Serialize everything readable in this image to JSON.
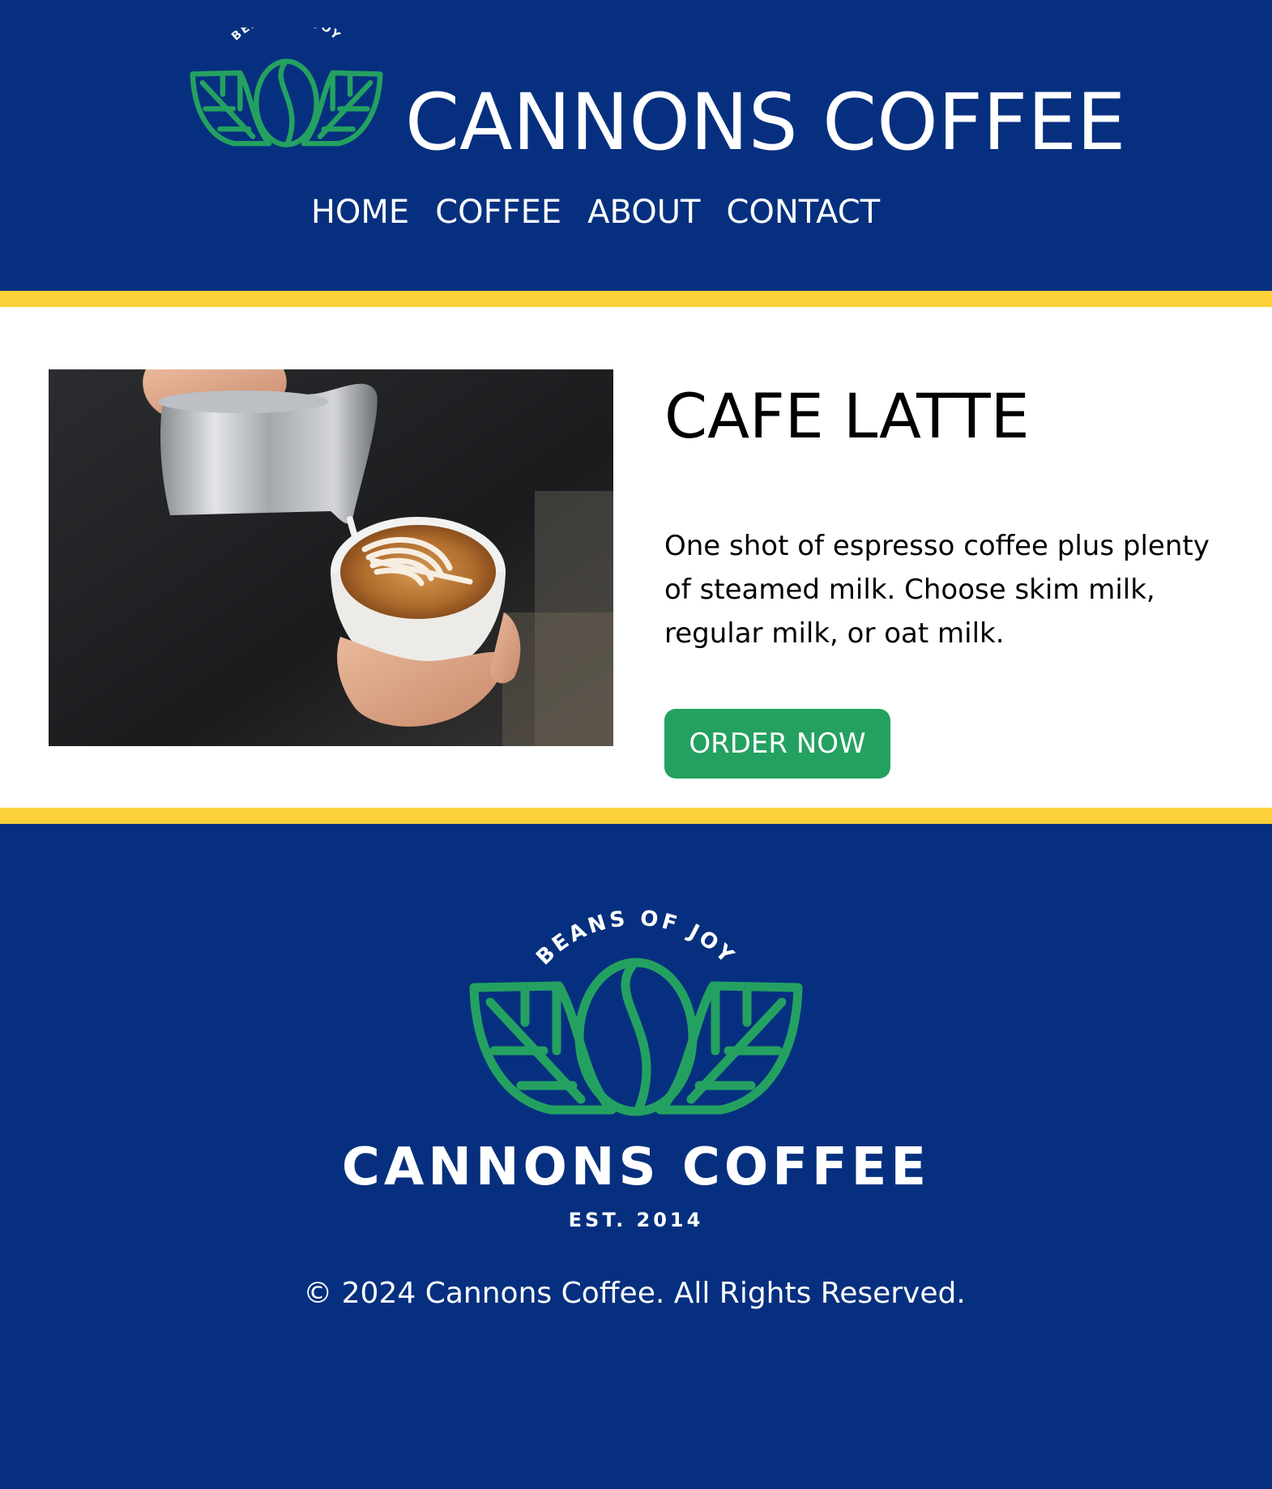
{
  "brand": {
    "name": "CANNONS COFFEE",
    "tagline": "BEANS OF JOY",
    "established": "EST. 2014"
  },
  "nav": {
    "items": [
      {
        "label": "HOME"
      },
      {
        "label": "COFFEE"
      },
      {
        "label": "ABOUT"
      },
      {
        "label": "CONTACT"
      }
    ]
  },
  "product": {
    "title": "CAFE LATTE",
    "description": "One shot of espresso coffee plus plenty of steamed milk. Choose skim milk, regular milk, or oat milk.",
    "order_label": "ORDER NOW",
    "image_icon": "latte-art-photo"
  },
  "footer": {
    "copyright": "© 2024 Cannons Coffee. All Rights Reserved."
  },
  "colors": {
    "navy": "#06307f",
    "yellow": "#fcd13a",
    "green": "#24a160",
    "white": "#ffffff"
  }
}
